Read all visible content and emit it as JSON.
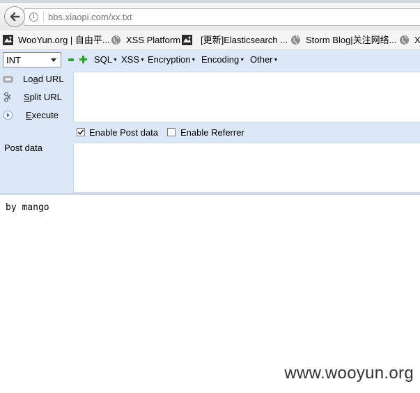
{
  "browser": {
    "url_text": "bbs.xiaopi.com/xx.txt"
  },
  "bookmarks": [
    {
      "label": "WooYun.org | 自由平...",
      "icon": "wooyun-favicon"
    },
    {
      "label": "XSS Platform",
      "icon": "globe-icon"
    },
    {
      "label": "[更新]Elasticsearch ...",
      "icon": "wooyun-favicon"
    },
    {
      "label": "Storm Blog|关注网络...",
      "icon": "globe-icon"
    },
    {
      "label": "XS",
      "icon": "globe-icon"
    }
  ],
  "hackbar": {
    "select_value": "INT",
    "menus": [
      "SQL",
      "XSS",
      "Encryption",
      "Encoding",
      "Other"
    ],
    "load_url": {
      "pre": "Lo",
      "key": "a",
      "post": "d URL"
    },
    "split_url": {
      "key": "S",
      "post": "plit URL"
    },
    "execute": {
      "key": "E",
      "post": "xecute"
    },
    "enable_post_label": "Enable Post data",
    "enable_post_checked": true,
    "enable_referrer_label": "Enable Referrer",
    "enable_referrer_checked": false,
    "post_data_label": "Post data",
    "url_value": "",
    "post_value": ""
  },
  "content": {
    "text": "by mango"
  },
  "watermark": "www.wooyun.org",
  "colors": {
    "hackbar_bg": "#dce8f7",
    "plus_minus": "#2c9c2c"
  }
}
